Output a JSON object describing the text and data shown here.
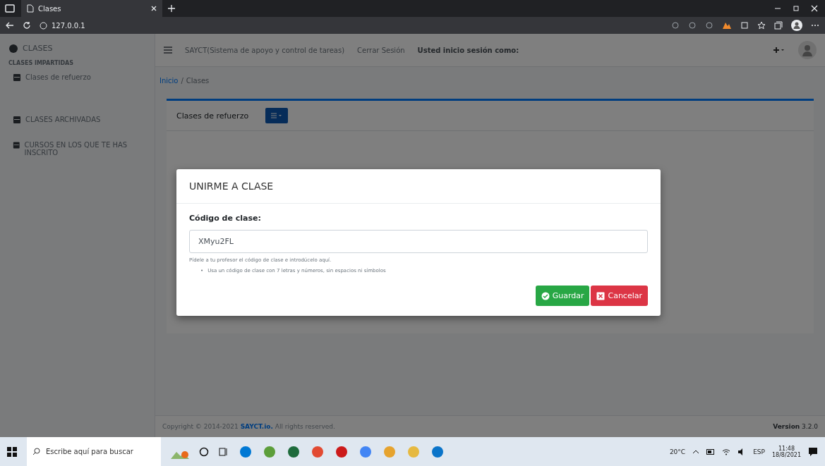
{
  "browser": {
    "tab_title": "Clases",
    "url": "127.0.0.1"
  },
  "sidebar": {
    "brand": "CLASES",
    "section": "CLASES IMPARTIDAS",
    "items": [
      {
        "label": "Clases de refuerzo"
      },
      {
        "label": "CLASES ARCHIVADAS"
      },
      {
        "label": "CURSOS EN LOS QUE TE HAS INSCRITO"
      }
    ]
  },
  "header": {
    "title": "SAYCT(Sistema de apoyo y control de tareas)",
    "logout": "Cerrar Sesión",
    "user_label": "Usted inicio sesión como:"
  },
  "breadcrumb": {
    "items": [
      "Inicio",
      "Clases"
    ],
    "separator": "/"
  },
  "card": {
    "tab": "Clases de refuerzo"
  },
  "modal": {
    "title": "UNIRME A CLASE",
    "field_label": "Código de clase:",
    "field_value": "XMyu2FL",
    "help": "Pídele a tu profesor el código de clase e introdúcelo aquí.",
    "hint_marker": "•",
    "hints": [
      "Usa un código de clase con 7 letras y números, sin espacios ni símbolos"
    ],
    "buttons": [
      {
        "label": "Guardar",
        "kind": "save"
      },
      {
        "label": "Cancelar",
        "kind": "cancel"
      }
    ]
  },
  "footer": {
    "copyright": "Copyright © 2014-2021 ",
    "link": "SAYCT.io.",
    "rights": " All rights reserved.",
    "version": "**Version** 3.2.0"
  },
  "taskbar": {
    "search_placeholder": "Escribe aquí para buscar",
    "weather": "20°C",
    "lang": "ESP",
    "time": "11:48",
    "date": "18/8/2021"
  }
}
